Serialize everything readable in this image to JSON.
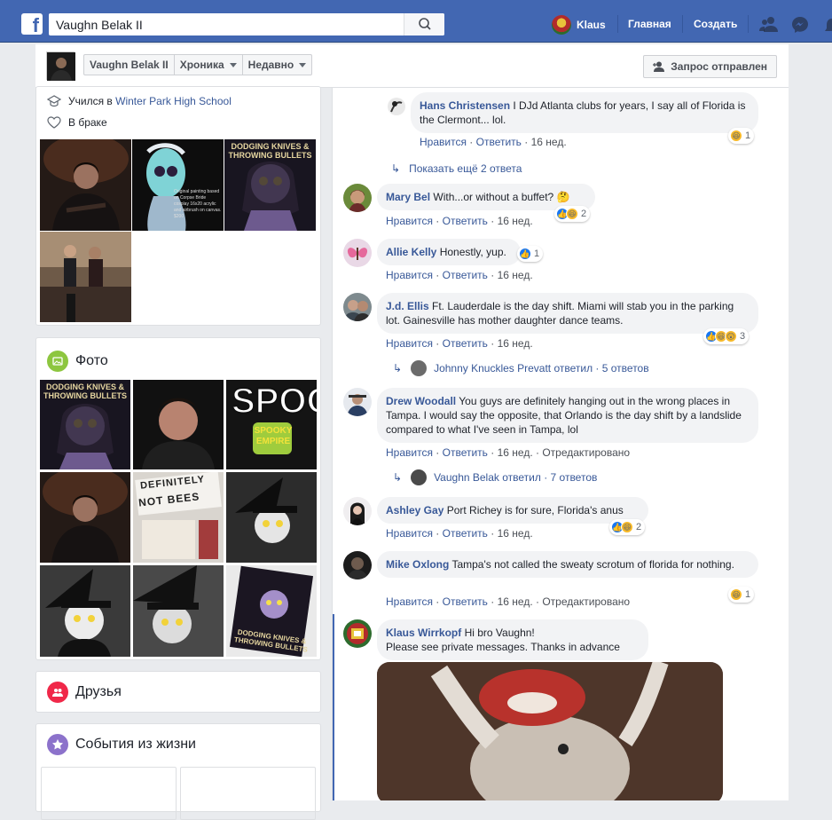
{
  "topbar": {
    "logo": "f",
    "search_value": "Vaughn Belak II",
    "user_name": "Klaus",
    "nav_home": "Главная",
    "nav_create": "Создать"
  },
  "subbar": {
    "crumb_name": "Vaughn Belak II",
    "crumb_timeline": "Хроника",
    "crumb_recent": "Недавно",
    "request_button": "Запрос отправлен"
  },
  "intro": {
    "studied_prefix": "Учился в ",
    "school": "Winter Park High School",
    "relationship": "В браке",
    "painting_caption": "Original painting based on Corpse Bride cosplay 16x20 acrylic and airbrush on canvas. $200"
  },
  "photos": {
    "title": "Фото",
    "book_title_1": "DODGING KNIVES & THROWING BULLETS",
    "spooky": "SPOO",
    "spooky_empire": "SPOOKY EMPIRE",
    "sign_line_1": "DEFINITELY",
    "sign_line_2": "NOT BEES"
  },
  "friends": {
    "title": "Друзья"
  },
  "events": {
    "title": "События из жизни"
  },
  "comments": [
    {
      "name": "Hans Christensen",
      "text": " I DJd Atlanta clubs for years, I say all of Florida is the Clermont... lol.",
      "like": "Нравится",
      "reply": "Ответить",
      "time": "16 нед.",
      "count": "1"
    },
    {
      "more": "Показать ещё 2 ответа"
    },
    {
      "name": "Mary Bel",
      "text": " With...or without a buffet? 🤔",
      "like": "Нравится",
      "reply": "Ответить",
      "time": "16 нед.",
      "count": "2"
    },
    {
      "name": "Allie Kelly",
      "text": " Honestly, yup.",
      "like": "Нравится",
      "reply": "Ответить",
      "time": "16 нед.",
      "count": "1"
    },
    {
      "name": "J.d. Ellis",
      "text": " Ft. Lauderdale is the day shift. Miami will stab you in the parking lot. Gainesville has mother daughter dance teams.",
      "like": "Нравится",
      "reply": "Ответить",
      "time": "16 нед.",
      "count": "3",
      "replied_by": "Johnny Knuckles Prevatt ответил",
      "replies": "5 ответов"
    },
    {
      "name": "Drew Woodall",
      "text": " You guys are definitely hanging out in the wrong places in Tampa. I would say the opposite, that Orlando is the day shift by a landslide compared to what I've seen in Tampa, lol",
      "like": "Нравится",
      "reply": "Ответить",
      "time": "16 нед.",
      "edited": "Отредактировано",
      "replied_by": "Vaughn Belak ответил",
      "replies": "7 ответов"
    },
    {
      "name": "Ashley Gay",
      "text": " Port Richey is for sure, Florida's anus",
      "like": "Нравится",
      "reply": "Ответить",
      "time": "16 нед.",
      "count": "2"
    },
    {
      "name": "Mike Oxlong",
      "text": " Tampa's not called the sweaty scrotum of florida for nothing.",
      "like": "Нравится",
      "reply": "Ответить",
      "time": "16 нед.",
      "edited": "Отредактировано",
      "count": "1"
    },
    {
      "name": "Klaus Wirrkopf",
      "text": " Hi bro Vaughn!",
      "text2": "Please see private messages. Thanks in advance"
    }
  ],
  "colors": {
    "brand": "#4267b2",
    "link": "#385898",
    "photos_icon": "#8dc63f",
    "friends_icon": "#f02849",
    "events_icon": "#8c72cb"
  }
}
